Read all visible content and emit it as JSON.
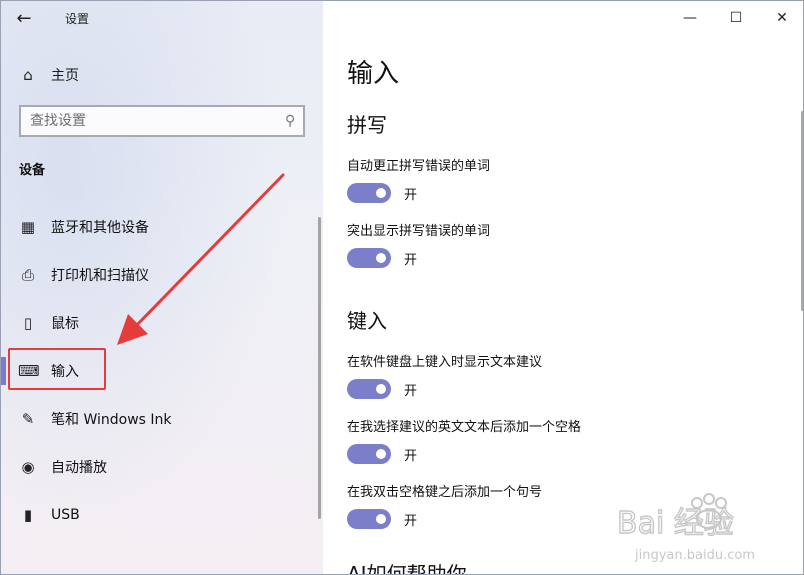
{
  "window": {
    "title": "设置",
    "back_icon": "back-arrow-icon",
    "controls": {
      "minimize": "—",
      "maximize": "☐",
      "close": "✕"
    }
  },
  "sidebar": {
    "home": {
      "label": "主页",
      "icon": "home-icon"
    },
    "search": {
      "placeholder": "查找设置",
      "icon": "search-icon"
    },
    "section_header": "设备",
    "items": [
      {
        "label": "蓝牙和其他设备",
        "icon": "bluetooth-devices-icon",
        "selected": false
      },
      {
        "label": "打印机和扫描仪",
        "icon": "printer-icon",
        "selected": false
      },
      {
        "label": "鼠标",
        "icon": "mouse-icon",
        "selected": false
      },
      {
        "label": "输入",
        "icon": "keyboard-icon",
        "selected": true
      },
      {
        "label": "笔和 Windows Ink",
        "icon": "pen-icon",
        "selected": false
      },
      {
        "label": "自动播放",
        "icon": "autoplay-icon",
        "selected": false
      },
      {
        "label": "USB",
        "icon": "usb-icon",
        "selected": false
      }
    ]
  },
  "main": {
    "page_title": "输入",
    "groups": [
      {
        "title": "拼写",
        "settings": [
          {
            "label": "自动更正拼写错误的单词",
            "state": "开",
            "on": true
          },
          {
            "label": "突出显示拼写错误的单词",
            "state": "开",
            "on": true
          }
        ]
      },
      {
        "title": "键入",
        "settings": [
          {
            "label": "在软件键盘上键入时显示文本建议",
            "state": "开",
            "on": true
          },
          {
            "label": "在我选择建议的英文文本后添加一个空格",
            "state": "开",
            "on": true
          },
          {
            "label": "在我双击空格键之后添加一个句号",
            "state": "开",
            "on": true
          }
        ]
      }
    ],
    "cutoff_heading": "AI如何帮助你"
  },
  "watermark": {
    "text": "Bai 经验",
    "url": "jingyan.baidu.com"
  },
  "colors": {
    "accent": "#7b7fc9",
    "annotation": "#e53b3b"
  }
}
